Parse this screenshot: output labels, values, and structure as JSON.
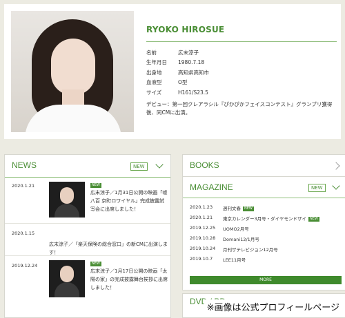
{
  "profile": {
    "name_en": "RYOKO HIROSUE",
    "info": [
      {
        "label": "名前",
        "value": "広末涼子"
      },
      {
        "label": "生年月日",
        "value": "1980.7.18"
      },
      {
        "label": "出身地",
        "value": "高知県高知市"
      },
      {
        "label": "血液型",
        "value": "O型"
      },
      {
        "label": "サイズ",
        "value": "H161/S23.5"
      }
    ],
    "bio": "デビュー：第一回クレアラシル『ぴかぴかフェイスコンテスト』グランプリ獲得後、同CMに出演。"
  },
  "news": {
    "title": "NEWS",
    "badge": "NEW",
    "items": [
      {
        "date": "2020.1.21",
        "new": "NEW",
        "text": "広末涼子／1月31日公開の映画「嘘八百 京町ロワイヤル」完成披露試写会に出席しました！"
      },
      {
        "date": "2020.1.15",
        "text": "広末涼子／「楽天保険の総合窓口」の新CMに出演します！"
      },
      {
        "date": "2019.12.24",
        "new": "NEW",
        "text": "広末涼子／1月17日公開の映画「太陽の家」の完成披露舞台挨拶に出席しました！"
      }
    ]
  },
  "books": {
    "title": "BOOKS"
  },
  "magazine": {
    "title": "MAGAZINE",
    "badge": "NEW",
    "items": [
      {
        "date": "2020.1.23",
        "title": "週刊文春",
        "new": "NEW"
      },
      {
        "date": "2020.1.21",
        "title": "東京カレンダー3月号・ダイヤモンドザイ",
        "new": "NEW"
      },
      {
        "date": "2019.12.25",
        "title": "UOMO2月号"
      },
      {
        "date": "2019.10.28",
        "title": "Domani12/1月号"
      },
      {
        "date": "2019.10.24",
        "title": "月刊ザテレビジョン12月号"
      },
      {
        "date": "2019.10.7",
        "title": "LEE11月号"
      }
    ],
    "more_label": "MORE"
  },
  "dvd": {
    "title": "DVD / BD"
  },
  "caption": "※画像は公式プロフィールページ",
  "colors": {
    "accent": "#4a8e35",
    "background": "#ecebe2"
  }
}
